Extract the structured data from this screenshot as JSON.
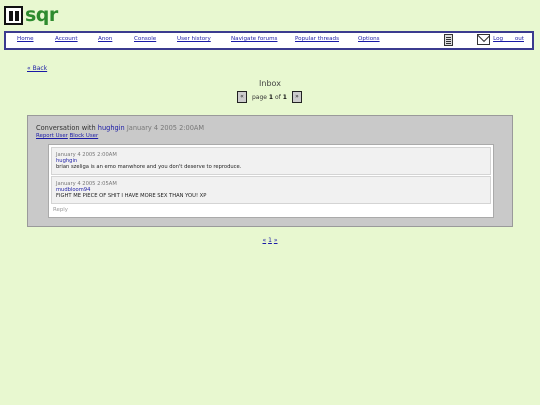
{
  "brand": {
    "logo_text": "sqr"
  },
  "nav": {
    "items": [
      "Home",
      "Account",
      "Anon",
      "Console",
      "User history",
      "Navigate forums",
      "Popular threads",
      "Options"
    ],
    "logout": "Log out"
  },
  "back_link": "« Back",
  "inbox": {
    "title": "Inbox",
    "pager": {
      "prev": "«",
      "next": "»",
      "page_word": "page",
      "current": "1",
      "of_word": "of",
      "total": "1"
    }
  },
  "conversation": {
    "prefix": "Conversation with",
    "with_user": "hughgin",
    "date": "January 4 2005 2:00AM",
    "actions": [
      "Report User",
      "Block User"
    ],
    "messages": [
      {
        "date": "January 4 2005 2:00AM",
        "user": "hughgin",
        "text": "brian szeliga is an emo manwhore and you don't deserve to reproduce."
      },
      {
        "date": "January 4 2005 2:05AM",
        "user": "mudbloom94",
        "text": "FIGHT ME PIECE OF SHIT I HAVE MORE SEX THAN YOU! XP"
      }
    ],
    "reply_placeholder": "Reply"
  },
  "bottom_pager": {
    "prev": "«",
    "page": "1",
    "next": "»"
  }
}
